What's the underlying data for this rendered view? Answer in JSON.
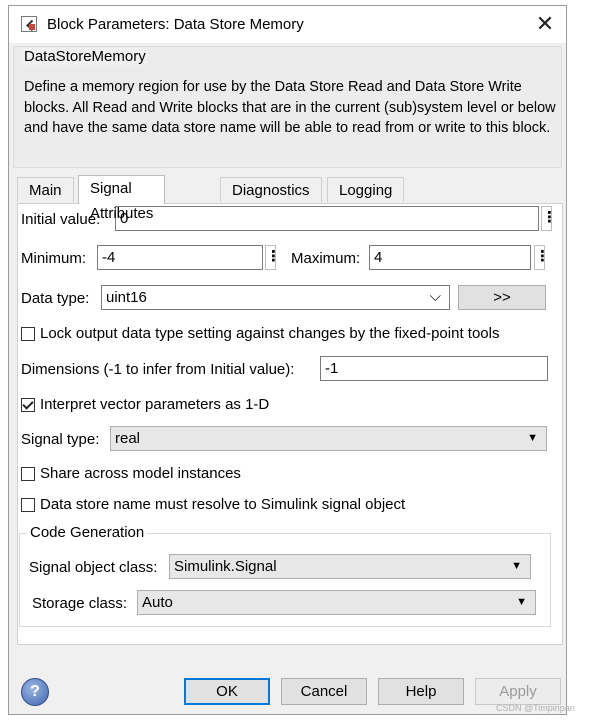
{
  "window": {
    "title": "Block Parameters: Data Store Memory",
    "close_glyph": "✕"
  },
  "description": {
    "heading": "DataStoreMemory",
    "text": "Define a memory region for use by the Data Store Read and Data Store Write blocks. All Read and Write blocks that are in the current (sub)system level or below and have the same data store name will be able to read from or write to this block."
  },
  "tabs": [
    {
      "label": "Main"
    },
    {
      "label": "Signal Attributes",
      "active": true
    },
    {
      "label": "Diagnostics"
    },
    {
      "label": "Logging"
    }
  ],
  "signal_attributes": {
    "initial_value_label": "Initial value:",
    "initial_value": "0",
    "minimum_label": "Minimum:",
    "minimum": "-4",
    "maximum_label": "Maximum:",
    "maximum": "4",
    "data_type_label": "Data type:",
    "data_type": "uint16",
    "data_type_assistant": ">>",
    "lock_label": "Lock output data type setting against changes by the fixed-point tools",
    "lock_checked": false,
    "dimensions_label": "Dimensions (-1 to infer from Initial value):",
    "dimensions": "-1",
    "interpret_label": "Interpret vector parameters as 1-D",
    "interpret_checked": true,
    "signal_type_label": "Signal type:",
    "signal_type": "real",
    "share_label": "Share across model instances",
    "share_checked": false,
    "resolve_label": "Data store name must resolve to Simulink signal object",
    "resolve_checked": false
  },
  "code_generation": {
    "heading": "Code Generation",
    "signal_object_class_label": "Signal object class:",
    "signal_object_class": "Simulink.Signal",
    "storage_class_label": "Storage class:",
    "storage_class": "Auto"
  },
  "buttons": {
    "ok": "OK",
    "cancel": "Cancel",
    "help": "Help",
    "apply": "Apply"
  },
  "watermark": "CSDN @Timpinpan",
  "colors": {
    "focus_border": "#0078d7",
    "dialog_bg": "#f0f0f0"
  }
}
